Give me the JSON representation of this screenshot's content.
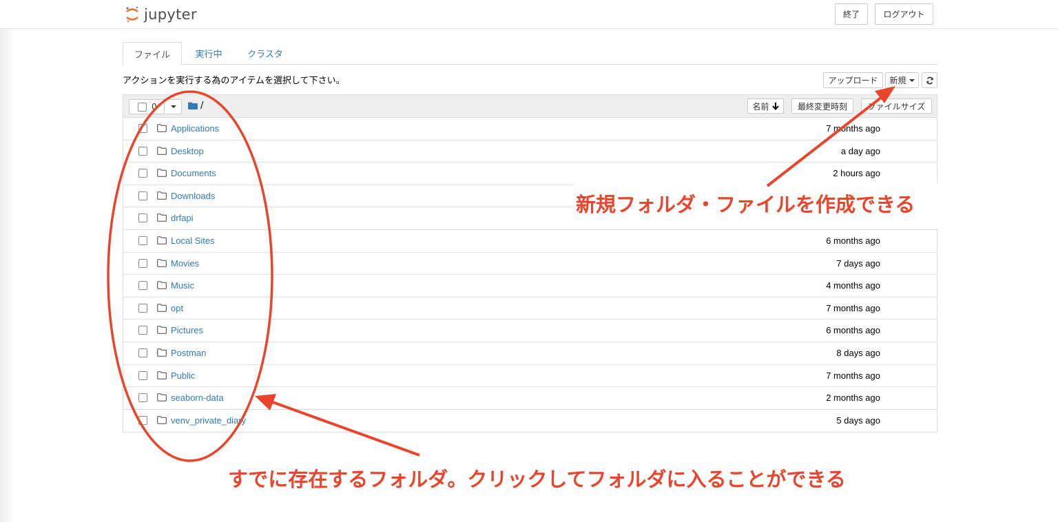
{
  "app": {
    "logo_text": "jupyter",
    "quit_label": "終了",
    "logout_label": "ログアウト"
  },
  "tabs": [
    {
      "label": "ファイル",
      "active": true
    },
    {
      "label": "実行中",
      "active": false
    },
    {
      "label": "クラスタ",
      "active": false
    }
  ],
  "instructions": "アクションを実行する為のアイテムを選択して下さい。",
  "toolbar": {
    "upload_label": "アップロード",
    "new_label": "新規",
    "refresh_icon": "refresh-icon"
  },
  "list_header": {
    "selected_count": "0",
    "path": "/",
    "sort_name_label": "名前",
    "sort_modified_label": "最終変更時刻",
    "sort_size_label": "ファイルサイズ"
  },
  "items": [
    {
      "name": "Applications",
      "modified": "7 months ago"
    },
    {
      "name": "Desktop",
      "modified": "a day ago"
    },
    {
      "name": "Documents",
      "modified": "2 hours ago"
    },
    {
      "name": "Downloads",
      "modified": ""
    },
    {
      "name": "drfapi",
      "modified": ""
    },
    {
      "name": "Local Sites",
      "modified": "6 months ago"
    },
    {
      "name": "Movies",
      "modified": "7 days ago"
    },
    {
      "name": "Music",
      "modified": "4 months ago"
    },
    {
      "name": "opt",
      "modified": "7 months ago"
    },
    {
      "name": "Pictures",
      "modified": "6 months ago"
    },
    {
      "name": "Postman",
      "modified": "8 days ago"
    },
    {
      "name": "Public",
      "modified": "7 months ago"
    },
    {
      "name": "seaborn-data",
      "modified": "2 months ago"
    },
    {
      "name": "venv_private_diary",
      "modified": "5 days ago"
    }
  ],
  "annotations": {
    "new_note": "新規フォルダ・ファイルを作成できる",
    "folders_note": "すでに存在するフォルダ。クリックしてフォルダに入ることができる",
    "color": "#e8452c"
  }
}
